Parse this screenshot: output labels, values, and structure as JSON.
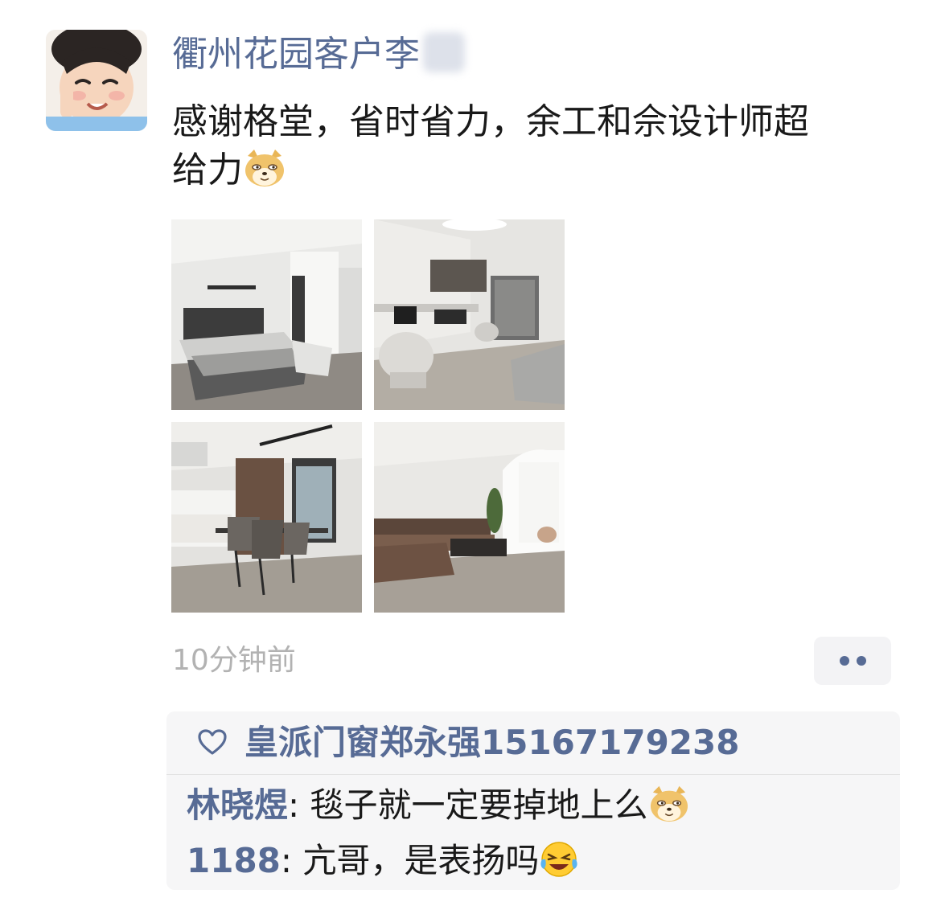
{
  "post": {
    "author": "衢州花园客户李",
    "text_line1": "感谢格堂，省时省力，余工和佘设计师超",
    "text_line2": "给力",
    "time": "10分钟前",
    "photos": [
      "bedroom-photo",
      "study-room-photo",
      "dining-room-photo",
      "living-room-photo"
    ]
  },
  "likes": {
    "names": "皇派门窗郑永强15167179238"
  },
  "comments": [
    {
      "name": "林晓煜",
      "separator": ": ",
      "text": "毯子就一定要掉地上么"
    },
    {
      "name": "1188",
      "separator": ": ",
      "text": "亢哥，是表扬吗"
    }
  ],
  "colors": {
    "link_blue": "#576b95",
    "timestamp_gray": "#b2b2b2",
    "comment_bg": "#f6f6f7"
  }
}
